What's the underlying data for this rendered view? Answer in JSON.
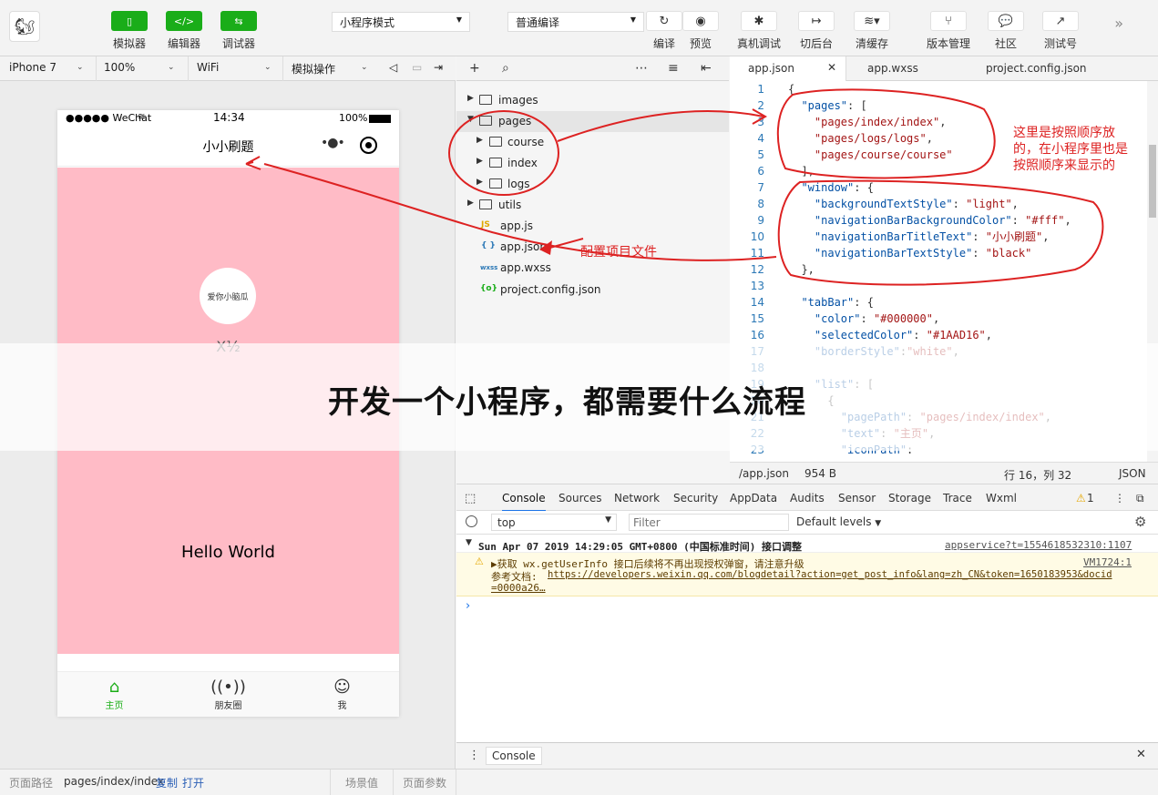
{
  "toolbar": {
    "modes": [
      {
        "label": "模拟器",
        "icon": "phone-icon"
      },
      {
        "label": "编辑器",
        "icon": "code-icon"
      },
      {
        "label": "调试器",
        "icon": "debug-icon"
      }
    ],
    "mode_select": "小程序模式",
    "compile_select": "普通编译",
    "actions": [
      {
        "label": "编译",
        "icon": "refresh-icon"
      },
      {
        "label": "预览",
        "icon": "eye-icon"
      },
      {
        "label": "真机调试",
        "icon": "bug-icon"
      },
      {
        "label": "切后台",
        "icon": "switch-icon"
      },
      {
        "label": "清缓存",
        "icon": "layers-icon"
      },
      {
        "label": "版本管理",
        "icon": "branch-icon"
      },
      {
        "label": "社区",
        "icon": "chat-icon"
      },
      {
        "label": "测试号",
        "icon": "share-icon"
      }
    ]
  },
  "devicebar": {
    "device": "iPhone 7",
    "zoom": "100%",
    "network": "WiFi",
    "operation": "模拟操作"
  },
  "phone": {
    "carrier": "●●●●● WeChat",
    "time": "14:34",
    "battery": "100%",
    "title": "小小刷题",
    "nickname": "X½",
    "hello": "Hello World",
    "avatar_text": "爱你小脑瓜",
    "tabs": [
      {
        "label": "主页",
        "icon": "home-icon",
        "active": true
      },
      {
        "label": "朋友圈",
        "icon": "radio-icon",
        "active": false
      },
      {
        "label": "我",
        "icon": "user-icon",
        "active": false
      }
    ],
    "colors": {
      "content_bg": "#ffbbc6",
      "active_tab": "#1aad16"
    }
  },
  "pathbar": {
    "label": "页面路径",
    "path": "pages/index/index",
    "copy": "复制",
    "open": "打开",
    "scene": "场景值",
    "params": "页面参数"
  },
  "filetree": [
    {
      "name": "images",
      "type": "folder",
      "depth": 0,
      "expanded": false
    },
    {
      "name": "pages",
      "type": "folder",
      "depth": 0,
      "expanded": true
    },
    {
      "name": "course",
      "type": "folder",
      "depth": 1,
      "expanded": false
    },
    {
      "name": "index",
      "type": "folder",
      "depth": 1,
      "expanded": false
    },
    {
      "name": "logs",
      "type": "folder",
      "depth": 1,
      "expanded": false
    },
    {
      "name": "utils",
      "type": "folder",
      "depth": 0,
      "expanded": false
    },
    {
      "name": "app.js",
      "type": "js",
      "depth": 0
    },
    {
      "name": "app.json",
      "type": "json",
      "depth": 0
    },
    {
      "name": "app.wxss",
      "type": "wxss",
      "depth": 0
    },
    {
      "name": "project.config.json",
      "type": "config",
      "depth": 0
    }
  ],
  "editor": {
    "tabs": [
      "app.json",
      "app.wxss",
      "project.config.json"
    ],
    "lines": [
      "{",
      "  \"pages\": [",
      "    \"pages/index/index\",",
      "    \"pages/logs/logs\",",
      "    \"pages/course/course\"",
      "  ],",
      "  \"window\": {",
      "    \"backgroundTextStyle\": \"light\",",
      "    \"navigationBarBackgroundColor\": \"#fff\",",
      "    \"navigationBarTitleText\": \"小小刷题\",",
      "    \"navigationBarTextStyle\": \"black\"",
      "  },",
      "",
      "  \"tabBar\": {",
      "    \"color\": \"#000000\",",
      "    \"selectedColor\": \"#1AAD16\",",
      "    \"borderStyle\":\"white\",",
      "",
      "    \"list\": [",
      "      {",
      "        \"pagePath\": \"pages/index/index\",",
      "        \"text\": \"主页\",",
      "        \"iconPath\":"
    ],
    "status": {
      "file": "/app.json",
      "size": "954 B",
      "position": "行 16，列 32",
      "lang": "JSON"
    }
  },
  "devtools": {
    "tabs": [
      "Console",
      "Sources",
      "Network",
      "Security",
      "AppData",
      "Audits",
      "Sensor",
      "Storage",
      "Trace",
      "Wxml"
    ],
    "warn_count": "1",
    "context": "top",
    "filter_placeholder": "Filter",
    "levels": "Default levels",
    "group_title": "Sun Apr 07 2019 14:29:05 GMT+0800 (中国标准时间) 接口调整",
    "group_link": "appservice?t=1554618532310:1107",
    "warn_line1": "▶获取 wx.getUserInfo 接口后续将不再出现授权弹窗，请注意升级",
    "warn_src": "VM1724:1",
    "warn_line2_label": "参考文档: ",
    "warn_url": "https://developers.weixin.qq.com/blogdetail?action=get_post_info&lang=zh_CN&token=1650183953&docid",
    "warn_url2": "=0000a26…",
    "drawer_tab": "Console"
  },
  "annotations": {
    "note_order": "这里是按照顺序放的，在小程序里也是按照顺序来显示的",
    "note_order_lines": [
      "这里是按照顺序放",
      "的，在小程序里也是",
      "按照顺序来显示的"
    ],
    "note_config": "配置项目文件"
  },
  "banner_title": "开发一个小程序，都需要什么流程"
}
